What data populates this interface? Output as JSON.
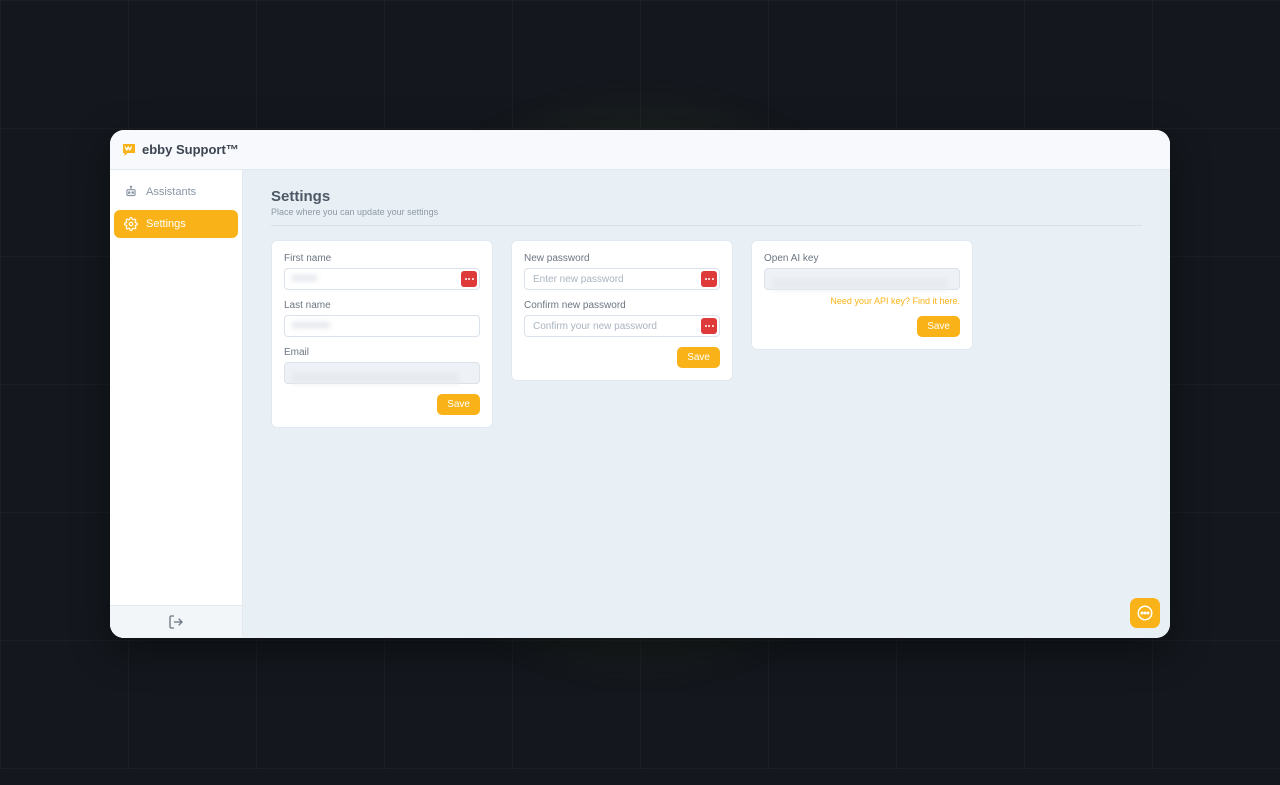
{
  "brand": {
    "name": "ebby Support™"
  },
  "sidebar": {
    "items": [
      {
        "label": "Assistants",
        "active": false
      },
      {
        "label": "Settings",
        "active": true
      }
    ]
  },
  "page": {
    "title": "Settings",
    "subtitle": "Place where you can update your settings"
  },
  "cards": {
    "profile": {
      "first_name_label": "First name",
      "first_name_value": "",
      "last_name_label": "Last name",
      "last_name_value": "",
      "email_label": "Email",
      "email_value": "",
      "save_label": "Save"
    },
    "password": {
      "new_label": "New password",
      "new_placeholder": "Enter new password",
      "confirm_label": "Confirm new password",
      "confirm_placeholder": "Confirm your new password",
      "save_label": "Save"
    },
    "openai": {
      "label": "Open AI key",
      "value": "",
      "help_link": "Need your API key? Find it here.",
      "save_label": "Save"
    }
  },
  "colors": {
    "accent": "#f9b318",
    "danger": "#de3a3a"
  }
}
